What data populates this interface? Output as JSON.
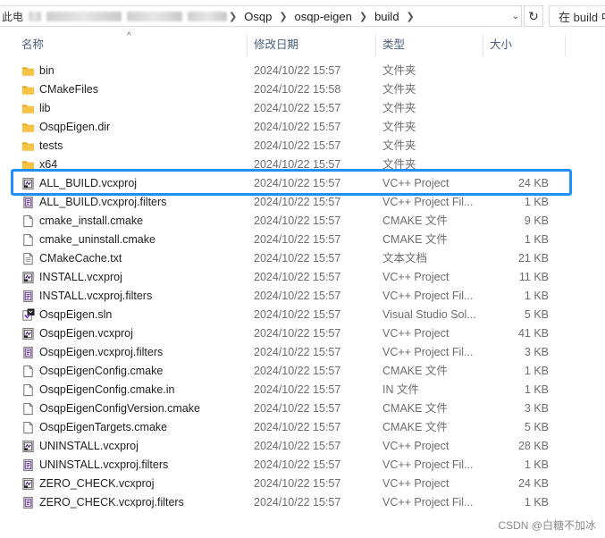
{
  "address": {
    "blurred_prefix": "此电",
    "crumbs": [
      "Osqp",
      "osqp-eigen",
      "build"
    ],
    "search_placeholder": "在 build 中"
  },
  "columns": {
    "name": "名称",
    "date": "修改日期",
    "type": "类型",
    "size": "大小"
  },
  "rows": [
    {
      "name": "bin",
      "date": "2024/10/22 15:57",
      "type": "文件夹",
      "size": "",
      "icon": "folder-icon"
    },
    {
      "name": "CMakeFiles",
      "date": "2024/10/22 15:58",
      "type": "文件夹",
      "size": "",
      "icon": "folder-icon"
    },
    {
      "name": "lib",
      "date": "2024/10/22 15:57",
      "type": "文件夹",
      "size": "",
      "icon": "folder-icon"
    },
    {
      "name": "OsqpEigen.dir",
      "date": "2024/10/22 15:57",
      "type": "文件夹",
      "size": "",
      "icon": "folder-icon"
    },
    {
      "name": "tests",
      "date": "2024/10/22 15:57",
      "type": "文件夹",
      "size": "",
      "icon": "folder-icon"
    },
    {
      "name": "x64",
      "date": "2024/10/22 15:57",
      "type": "文件夹",
      "size": "",
      "icon": "folder-icon"
    },
    {
      "name": "ALL_BUILD.vcxproj",
      "date": "2024/10/22 15:57",
      "type": "VC++ Project",
      "size": "24 KB",
      "icon": "vcxproj-icon"
    },
    {
      "name": "ALL_BUILD.vcxproj.filters",
      "date": "2024/10/22 15:57",
      "type": "VC++ Project Fil...",
      "size": "1 KB",
      "icon": "filters-icon"
    },
    {
      "name": "cmake_install.cmake",
      "date": "2024/10/22 15:57",
      "type": "CMAKE 文件",
      "size": "9 KB",
      "icon": "file-icon"
    },
    {
      "name": "cmake_uninstall.cmake",
      "date": "2024/10/22 15:57",
      "type": "CMAKE 文件",
      "size": "1 KB",
      "icon": "file-icon"
    },
    {
      "name": "CMakeCache.txt",
      "date": "2024/10/22 15:57",
      "type": "文本文档",
      "size": "21 KB",
      "icon": "text-file-icon"
    },
    {
      "name": "INSTALL.vcxproj",
      "date": "2024/10/22 15:57",
      "type": "VC++ Project",
      "size": "11 KB",
      "icon": "vcxproj-icon"
    },
    {
      "name": "INSTALL.vcxproj.filters",
      "date": "2024/10/22 15:57",
      "type": "VC++ Project Fil...",
      "size": "1 KB",
      "icon": "filters-icon"
    },
    {
      "name": "OsqpEigen.sln",
      "date": "2024/10/22 15:57",
      "type": "Visual Studio Sol...",
      "size": "5 KB",
      "icon": "sln-icon"
    },
    {
      "name": "OsqpEigen.vcxproj",
      "date": "2024/10/22 15:57",
      "type": "VC++ Project",
      "size": "41 KB",
      "icon": "vcxproj-icon"
    },
    {
      "name": "OsqpEigen.vcxproj.filters",
      "date": "2024/10/22 15:57",
      "type": "VC++ Project Fil...",
      "size": "3 KB",
      "icon": "filters-icon"
    },
    {
      "name": "OsqpEigenConfig.cmake",
      "date": "2024/10/22 15:57",
      "type": "CMAKE 文件",
      "size": "1 KB",
      "icon": "file-icon"
    },
    {
      "name": "OsqpEigenConfig.cmake.in",
      "date": "2024/10/22 15:57",
      "type": "IN 文件",
      "size": "1 KB",
      "icon": "file-icon"
    },
    {
      "name": "OsqpEigenConfigVersion.cmake",
      "date": "2024/10/22 15:57",
      "type": "CMAKE 文件",
      "size": "3 KB",
      "icon": "file-icon"
    },
    {
      "name": "OsqpEigenTargets.cmake",
      "date": "2024/10/22 15:57",
      "type": "CMAKE 文件",
      "size": "5 KB",
      "icon": "file-icon"
    },
    {
      "name": "UNINSTALL.vcxproj",
      "date": "2024/10/22 15:57",
      "type": "VC++ Project",
      "size": "28 KB",
      "icon": "vcxproj-icon"
    },
    {
      "name": "UNINSTALL.vcxproj.filters",
      "date": "2024/10/22 15:57",
      "type": "VC++ Project Fil...",
      "size": "1 KB",
      "icon": "filters-icon"
    },
    {
      "name": "ZERO_CHECK.vcxproj",
      "date": "2024/10/22 15:57",
      "type": "VC++ Project",
      "size": "24 KB",
      "icon": "vcxproj-icon"
    },
    {
      "name": "ZERO_CHECK.vcxproj.filters",
      "date": "2024/10/22 15:57",
      "type": "VC++ Project Fil...",
      "size": "1 KB",
      "icon": "filters-icon"
    }
  ],
  "highlighted_row": "ALL_BUILD.vcxproj",
  "colors": {
    "folder": "#f6c344",
    "highlight_border": "#1f8fff",
    "header_text": "#4c607a"
  },
  "watermark": "CSDN @白糖不加冰"
}
